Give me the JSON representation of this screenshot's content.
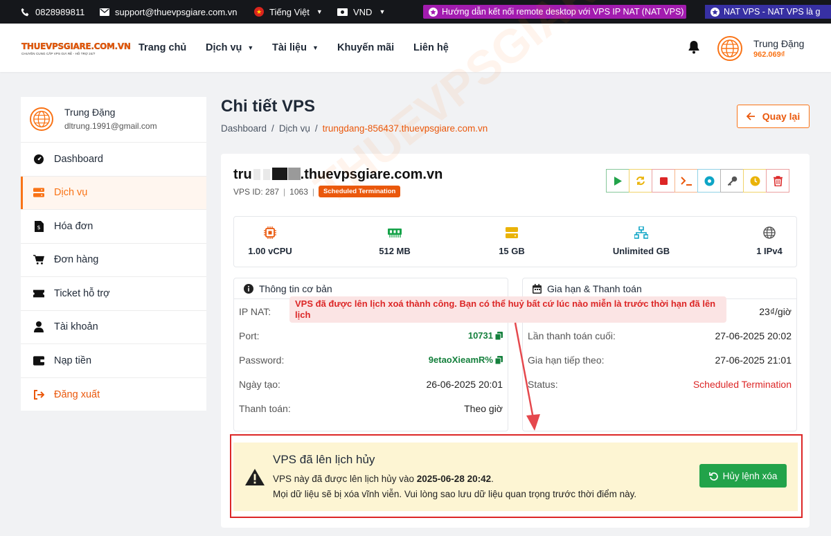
{
  "topbar": {
    "phone": "0828989811",
    "email": "support@thuevpsgiare.com.vn",
    "language": "Tiếng Việt",
    "currency": "VND",
    "promo1": "Hướng dẫn kết nối remote desktop với VPS IP NAT (NAT VPS)",
    "promo2": "NAT VPS - NAT VPS là g"
  },
  "logo": {
    "main": "THUEVPSGIARE.COM.VN",
    "sub": "CHUYÊN CUNG CẤP VPS GIÁ RẺ - HỖ TRỢ 24/7"
  },
  "nav": {
    "items": [
      "Trang chủ",
      "Dịch vụ",
      "Tài liệu",
      "Khuyến mãi",
      "Liên hệ"
    ],
    "user_name": "Trung Đặng",
    "balance": "962.069₫"
  },
  "sidebar": {
    "name": "Trung Đặng",
    "email": "dltrung.1991@gmail.com",
    "items": [
      "Dashboard",
      "Dịch vụ",
      "Hóa đơn",
      "Đơn hàng",
      "Ticket hỗ trợ",
      "Tài khoản",
      "Nạp tiền",
      "Đăng xuất"
    ]
  },
  "header": {
    "title": "Chi tiết VPS",
    "crumb_dashboard": "Dashboard",
    "crumb_service": "Dịch vụ",
    "crumb_current": "trungdang-856437.thuevpsgiare.com.vn",
    "back": "Quay lại"
  },
  "vps": {
    "host_prefix": "tru",
    "host_suffix": ".thuevpsgiare.com.vn",
    "id_label": "VPS ID: 287",
    "id2": "1063",
    "status_badge": "Scheduled Termination",
    "action_icons": [
      "play-icon",
      "refresh-icon",
      "stop-icon",
      "terminal-icon",
      "disc-icon",
      "key-icon",
      "clock-icon",
      "trash-icon"
    ]
  },
  "specs": {
    "cpu": "1.00 vCPU",
    "ram": "512 MB",
    "disk": "15 GB",
    "bandwidth": "Unlimited GB",
    "ip": "1 IPv4"
  },
  "basic": {
    "title": "Thông tin cơ bản",
    "ip_label": "IP NAT:",
    "port_label": "Port:",
    "port": "10731",
    "password_label": "Password:",
    "password": "9etaoXieamR%",
    "created_label": "Ngày tạo:",
    "created": "26-06-2025 20:01",
    "billing_label": "Thanh toán:",
    "billing": "Theo giờ"
  },
  "billing": {
    "title": "Gia hạn & Thanh toán",
    "price": "23₫/giờ",
    "last_label": "Lần thanh toán cuối:",
    "last": "27-06-2025 20:02",
    "next_label": "Gia hạn tiếp theo:",
    "next": "27-06-2025 21:01",
    "status_label": "Status:",
    "status": "Scheduled Termination"
  },
  "toast": "VPS đã được lên lịch xoá thành công. Bạn có thể huỷ bất cứ lúc nào miễn là trước thời hạn đã lên lịch",
  "alert": {
    "title": "VPS đã lên lịch hủy",
    "line1_prefix": "VPS này đã được lên lịch hủy vào ",
    "line1_date": "2025-06-28 20:42",
    "line1_suffix": ".",
    "line2": "Mọi dữ liệu sẽ bị xóa vĩnh viễn. Vui lòng sao lưu dữ liệu quan trọng trước thời điểm này.",
    "button": "Hủy lệnh xóa"
  },
  "colors": {
    "accent": "#f97316",
    "danger": "#dc2626",
    "success": "#22a34a",
    "alert_bg": "#fdf5d3"
  }
}
